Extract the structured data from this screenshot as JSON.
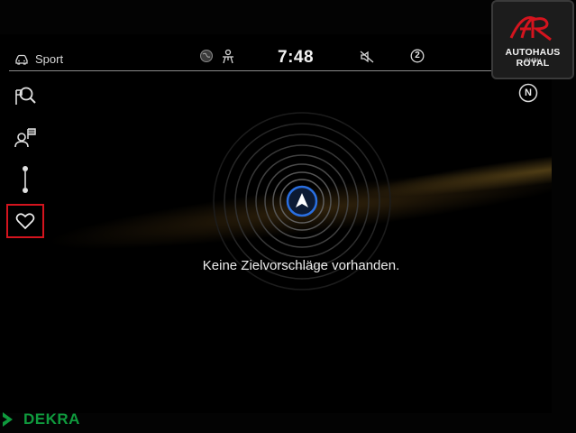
{
  "status_bar": {
    "drive_mode": "Sport",
    "time": "7:48",
    "notification_count": "2",
    "icons": [
      "car-icon",
      "globe-icon",
      "driver-icon",
      "audio-muted-icon",
      "notification-icon"
    ]
  },
  "left_rail": {
    "items": [
      {
        "icon": "destination-search-icon"
      },
      {
        "icon": "contact-destination-icon"
      },
      {
        "icon": "route-icon"
      },
      {
        "icon": "favorites-heart-icon",
        "selected": true
      }
    ]
  },
  "compass": {
    "label": "N"
  },
  "main": {
    "message": "Keine Zielvorschläge vorhanden."
  },
  "overlay": {
    "dealer_name": "AUTOHAUS ROYAL",
    "dealer_sub": "GMBH",
    "watermark": "DEKRA"
  },
  "colors": {
    "accent_selected": "#d4141e",
    "position_marker": "#2a6fe0",
    "dekra_green": "#0f9a3d"
  }
}
